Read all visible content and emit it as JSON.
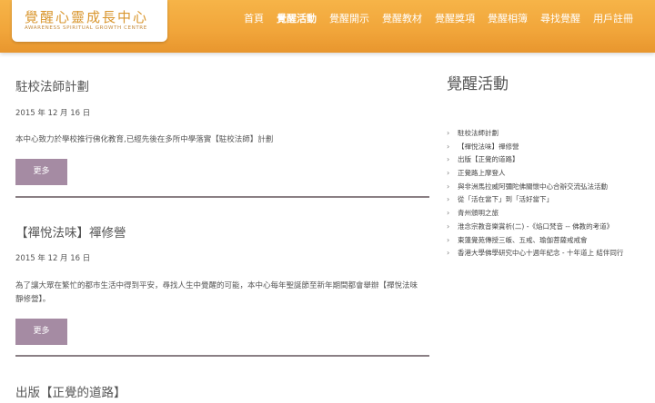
{
  "header": {
    "logo_title": "覺醒心靈成長中心",
    "logo_subtitle": "AWARENESS SPIRITUAL GROWTH CENTRE",
    "nav": [
      "首頁",
      "覺醒活動",
      "覺醒開示",
      "覺醒教材",
      "覺醒獎項",
      "覺醒相簿",
      "尋找覺醒",
      "用戶註冊"
    ],
    "active_nav": "覺醒活動"
  },
  "posts": [
    {
      "title": "駐校法師計劃",
      "date": "2015 年 12 月 16 日",
      "excerpt": "本中心致力於學校推行佛化教育,已經先後在多所中學落實【駐校法師】計劃",
      "more": "更多"
    },
    {
      "title": "【禪悅法味】禪修營",
      "date": "2015 年 12 月 16 日",
      "excerpt": "為了讓大眾在繁忙的都市生活中得到平安，尋找人生中覺醒的可能，本中心每年聖誕節至新年期間都會舉辦【禪悅法味靜修營】。",
      "more": "更多"
    },
    {
      "title": "出版【正覺的道路】"
    }
  ],
  "sidebar": {
    "title": "覺醒活動",
    "items": [
      "駐校法師計劃",
      "【禪悅法味】禪修營",
      "出版【正覺的道路】",
      "正覺路上摩登人",
      "與非洲馬拉威阿彌陀佛關懷中心合辦交流弘法活動",
      "從「活在當下」到「活好當下」",
      "青州頒明之旅",
      "淮念宗教音樂賞析(二) -《焰口梵音 -- 佛教的考道》",
      "東蓮覺苑傳授三皈、五戒、瑜伽菩薩戒戒會",
      "香港大學佛學研究中心十週年紀念 - 十年道上 結伴同行"
    ]
  }
}
